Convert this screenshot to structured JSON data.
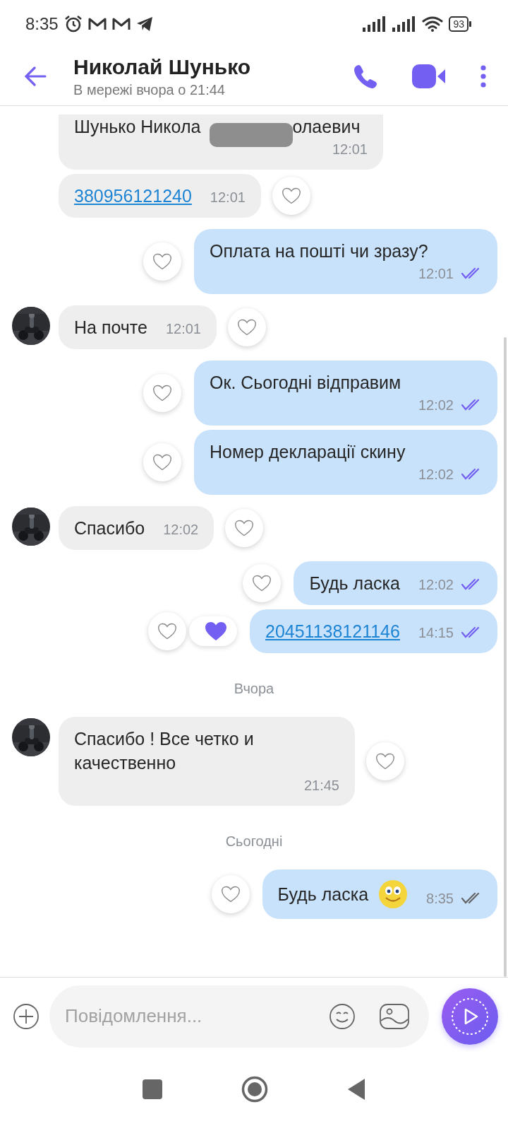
{
  "status_bar": {
    "time": "8:35",
    "battery": "93"
  },
  "header": {
    "title": "Николай Шунько",
    "subtitle": "В мережі вчора о 21:44"
  },
  "messages": [
    {
      "kind": "cut",
      "outgoing": false,
      "text_parts": [
        "Шунько Никола",
        "олаевич"
      ],
      "time": "12:01"
    },
    {
      "kind": "link",
      "outgoing": false,
      "text": "380956121240",
      "time": "12:01"
    },
    {
      "kind": "text",
      "outgoing": true,
      "text": "Оплата на пошті чи зразу?",
      "time": "12:01",
      "read": true
    },
    {
      "kind": "text",
      "outgoing": false,
      "text": "На почте",
      "time": "12:01",
      "avatar": true
    },
    {
      "kind": "text",
      "outgoing": true,
      "text": "Ок. Сьогодні відправим",
      "time": "12:02",
      "read": true
    },
    {
      "kind": "text",
      "outgoing": true,
      "text": "Номер декларації скину",
      "time": "12:02",
      "read": true
    },
    {
      "kind": "text",
      "outgoing": false,
      "text": "Спасибо",
      "time": "12:02",
      "avatar": true
    },
    {
      "kind": "text",
      "outgoing": true,
      "text": "Будь ласка",
      "time": "12:02",
      "read": true
    },
    {
      "kind": "link",
      "outgoing": true,
      "text": "20451138121146",
      "time": "14:15",
      "read": true,
      "reacted": true
    },
    {
      "kind": "date",
      "text": "Вчора"
    },
    {
      "kind": "text",
      "outgoing": false,
      "text": "Спасибо ! Все четко и качественно",
      "time": "21:45",
      "avatar": true
    },
    {
      "kind": "date",
      "text": "Сьогодні"
    },
    {
      "kind": "text",
      "outgoing": true,
      "text": "Будь ласка",
      "time": "8:35",
      "read": false,
      "emoji": true
    }
  ],
  "composer": {
    "placeholder": "Повідомлення..."
  }
}
